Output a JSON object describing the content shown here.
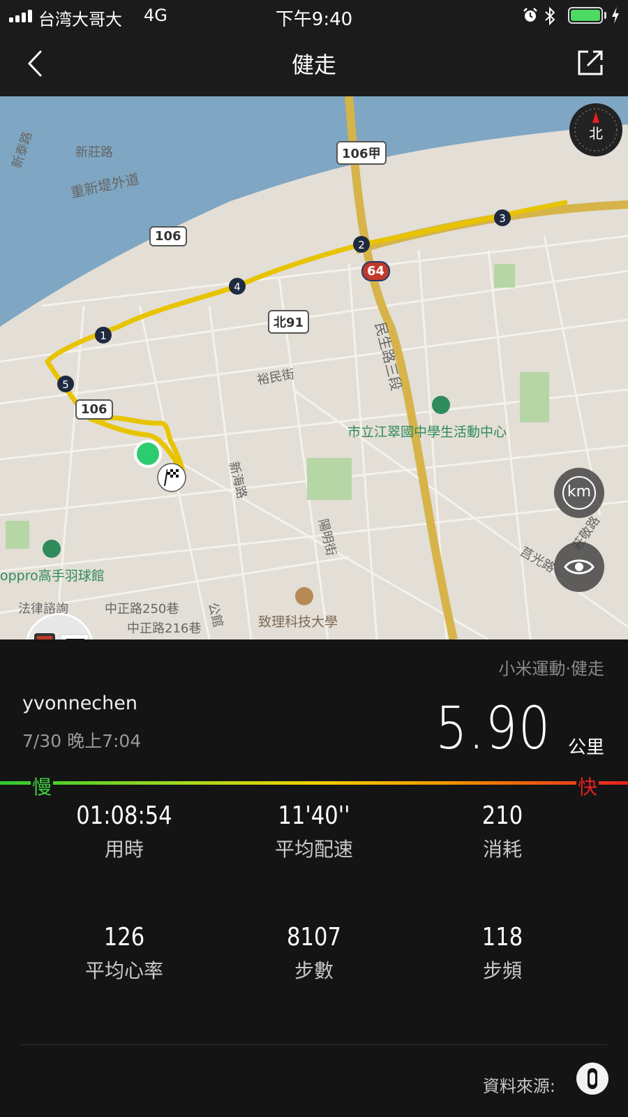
{
  "status_bar": {
    "carrier": "台湾大哥大",
    "network": "4G",
    "time": "下午9:40",
    "battery_level": 1.0,
    "icons": [
      "signal-icon",
      "alarm-icon",
      "bluetooth-icon",
      "battery-icon",
      "charging-icon"
    ]
  },
  "header": {
    "title": "健走",
    "back_icon": "chevron-left-icon",
    "share_icon": "share-icon"
  },
  "map": {
    "labels": {
      "xinzhuang_road": "新莊路",
      "xintai_road": "新泰路",
      "chongxin_road": "重新堤外道",
      "yumin_st": "裕民街",
      "minsheng_road": "民生路三段",
      "xinhai_road": "新海路",
      "yangming_st": "陽明街",
      "activity_center": "市立江翠國中學生活動中心",
      "badminton": "oppro高手羽球館",
      "university": "致理科技大學",
      "zhongzheng_lane": "中正路250巷",
      "zhongzheng_lane2": "中正路216巷",
      "law": "法律諮詢",
      "gong": "公館",
      "zhuang_jing": "莊敬路",
      "ju_guang": "莒光路"
    },
    "shields": {
      "r106a": "106甲",
      "r106": "106",
      "r64": "64",
      "bei91": "北91",
      "r106b": "106"
    },
    "km_markers": [
      "1",
      "2",
      "3",
      "4",
      "5"
    ],
    "km_button": "km",
    "compass_label": "北"
  },
  "workout": {
    "source_app": "小米運動·健走",
    "username": "yvonnechen",
    "datetime": "7/30 晚上7:04",
    "distance": "5.90",
    "distance_unit": "公里",
    "slow_label": "慢",
    "fast_label": "快"
  },
  "stats": [
    {
      "value": "01:08:54",
      "label": "用時"
    },
    {
      "value": "11'40''",
      "label": "平均配速"
    },
    {
      "value": "210",
      "label": "消耗"
    },
    {
      "value": "126",
      "label": "平均心率"
    },
    {
      "value": "8107",
      "label": "步數"
    },
    {
      "value": "118",
      "label": "步頻"
    }
  ],
  "footer": {
    "data_source_label": "資料來源:"
  },
  "colors": {
    "route": "#e8c400",
    "river": "#7fa6c2",
    "start_marker": "#2ecc71",
    "speed_slow": "#2ecc2e",
    "speed_fast": "#e52020"
  }
}
